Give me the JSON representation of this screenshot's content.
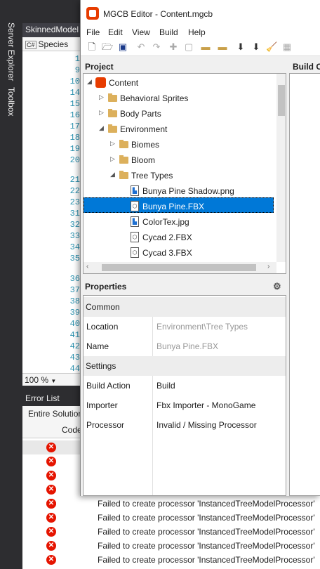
{
  "vs": {
    "side_tabs": [
      "Server Explorer",
      "Toolbox"
    ],
    "editor_tab": "SkinnedModel",
    "species_label": "Species",
    "line_numbers": [
      "1",
      "9",
      "10",
      "14",
      "15",
      "16",
      "17",
      "18",
      "19",
      "20",
      "21",
      "22",
      "23",
      "31",
      "32",
      "33",
      "34",
      "35",
      "36",
      "37",
      "38",
      "39",
      "40",
      "41",
      "42",
      "43",
      "44"
    ],
    "zoom": "100 %",
    "error_list_title": "Error List",
    "error_filter": "Entire Solution",
    "code_header": "Code",
    "error_messages": [
      "",
      "",
      "",
      "",
      "",
      "Failed to create processor 'InstancedTreeModelProcessor'",
      "Failed to create processor 'InstancedTreeModelProcessor'",
      "Failed to create processor 'InstancedTreeModelProcessor'",
      "Failed to create processor 'InstancedTreeModelProcessor'",
      "Failed to create processor 'InstancedTreeModelProcessor'"
    ]
  },
  "mgcb": {
    "title": "MGCB Editor - Content.mgcb",
    "menu": [
      "File",
      "Edit",
      "View",
      "Build",
      "Help"
    ],
    "project_header": "Project",
    "build_header": "Build Output",
    "tree": {
      "root": "Content",
      "behavioral": "Behavioral Sprites",
      "body": "Body Parts",
      "environment": "Environment",
      "biomes": "Biomes",
      "bloom": "Bloom",
      "tree_types": "Tree Types",
      "f1": "Bunya Pine Shadow.png",
      "f2": "Bunya Pine.FBX",
      "f3": "ColorTex.jpg",
      "f4": "Cycad 2.FBX",
      "f5": "Cycad 3.FBX"
    },
    "properties_header": "Properties",
    "props": {
      "common": "Common",
      "location_k": "Location",
      "location_v": "Environment\\Tree Types",
      "name_k": "Name",
      "name_v": "Bunya Pine.FBX",
      "settings": "Settings",
      "build_action_k": "Build Action",
      "build_action_v": "Build",
      "importer_k": "Importer",
      "importer_v": "Fbx Importer - MonoGame",
      "processor_k": "Processor",
      "processor_v": "Invalid / Missing Processor"
    }
  }
}
